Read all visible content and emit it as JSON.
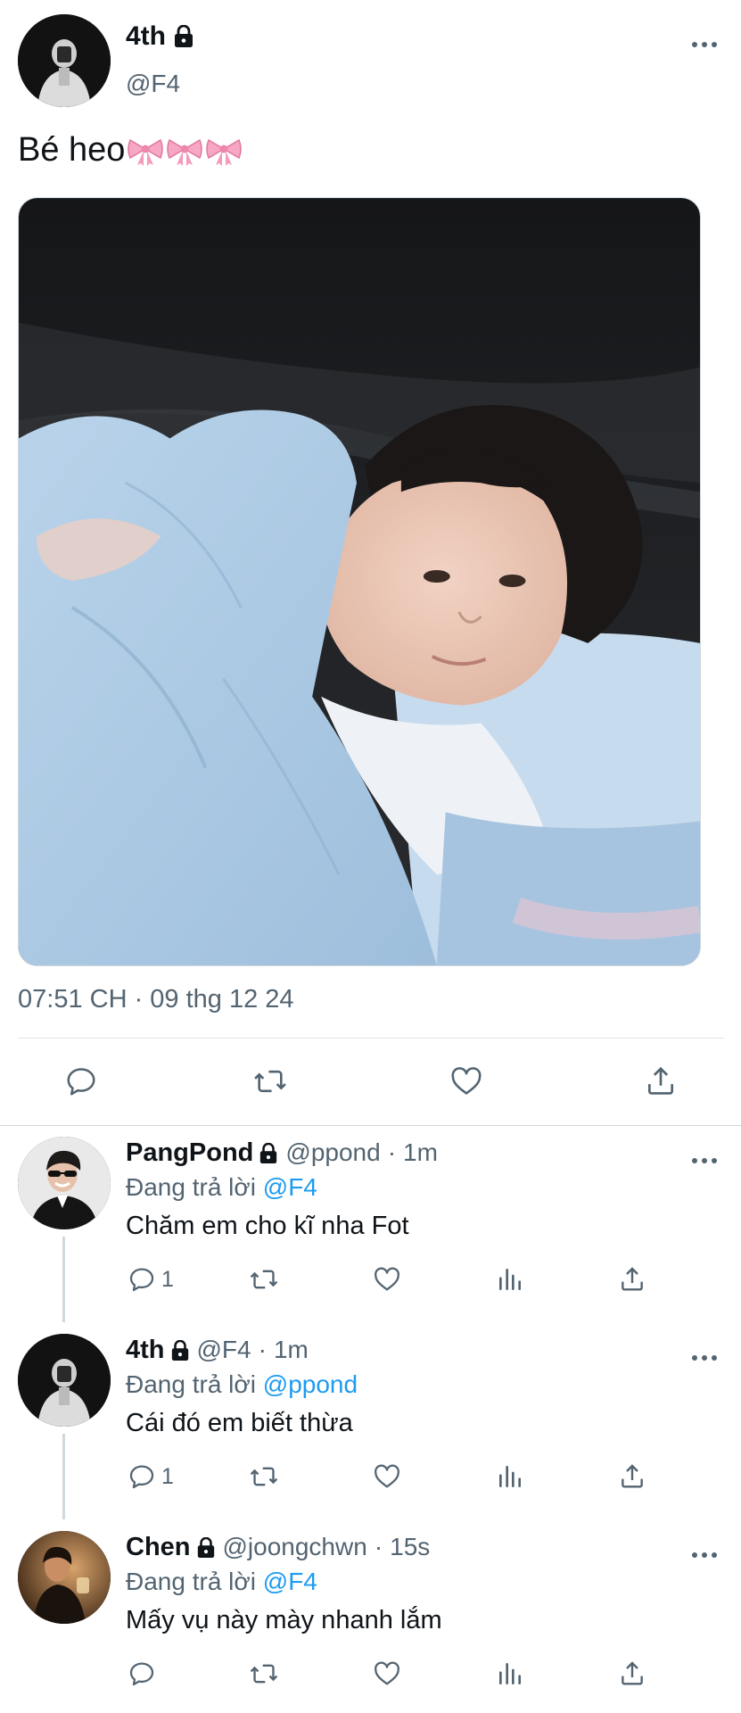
{
  "post": {
    "author_name": "4th",
    "author_handle": "@F4",
    "text": "Bé heo",
    "emoji_name": "pink-ribbon",
    "emoji_count": 3,
    "timestamp": "07:51 CH · 09 thg 12 24"
  },
  "replies": [
    {
      "name": "PangPond",
      "handle": "@ppond",
      "sep": "·",
      "time": "1m",
      "replying_label": "Đang trả lời",
      "replying_to": "@F4",
      "text": "Chăm em cho kĩ nha Fot",
      "reply_count": "1"
    },
    {
      "name": "4th",
      "handle": "@F4",
      "sep": "·",
      "time": "1m",
      "replying_label": "Đang trả lời",
      "replying_to": "@ppond",
      "text": "Cái đó em biết thừa",
      "reply_count": "1"
    },
    {
      "name": "Chen",
      "handle": "@joongchwn",
      "sep": "·",
      "time": "15s",
      "replying_label": "Đang trả lời",
      "replying_to": "@F4",
      "text": "Mấy vụ này mày nhanh lắm",
      "reply_count": ""
    }
  ],
  "colors": {
    "text": "#0f1419",
    "secondary": "#536471",
    "accent": "#1d9bf0",
    "divider": "#cfd9de"
  },
  "icons": [
    "lock-icon",
    "more-icon",
    "reply-icon",
    "retweet-icon",
    "like-icon",
    "views-icon",
    "share-icon"
  ]
}
